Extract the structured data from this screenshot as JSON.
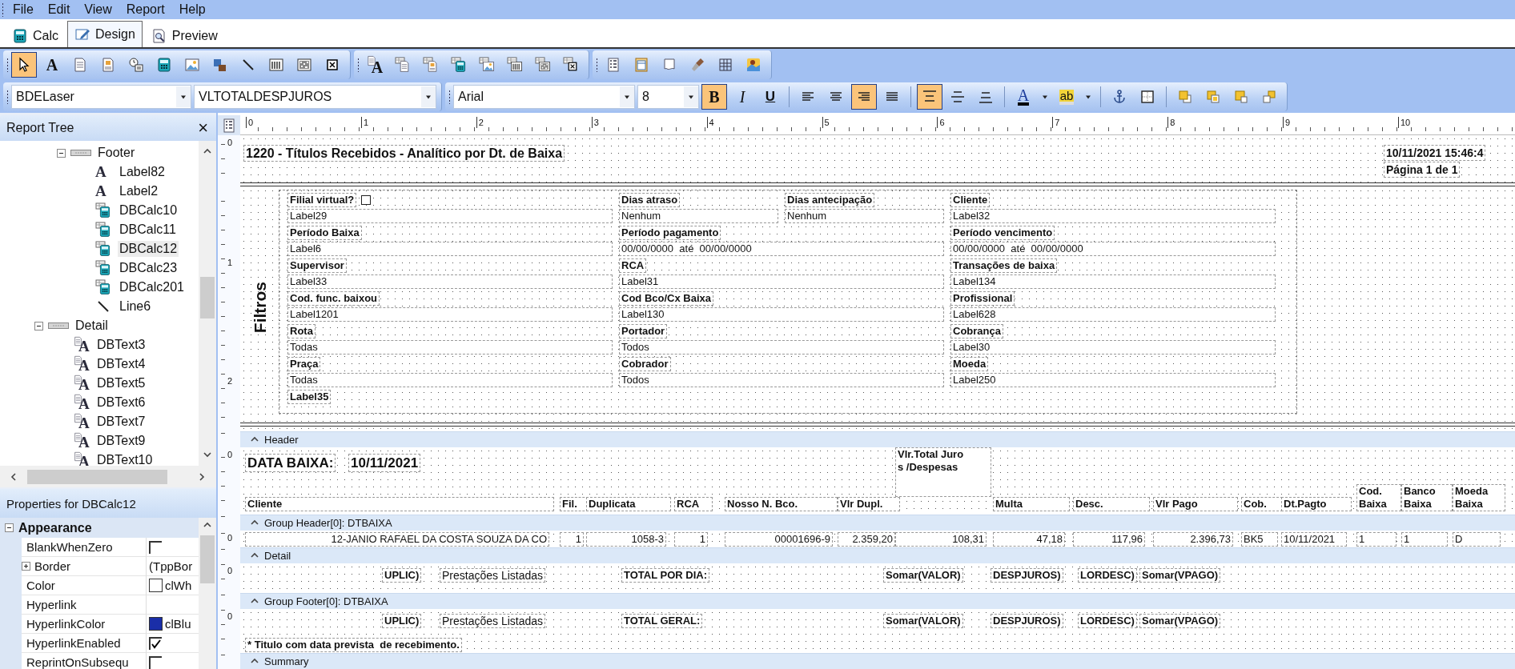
{
  "menu": [
    "File",
    "Edit",
    "View",
    "Report",
    "Help"
  ],
  "tabs": [
    {
      "label": "Calc",
      "selected": false
    },
    {
      "label": "Design",
      "selected": true
    },
    {
      "label": "Preview",
      "selected": false
    }
  ],
  "toolbar_components": {
    "groups": [
      [
        {
          "kind": "pointer",
          "selected": true
        },
        {
          "kind": "letter",
          "glyph": "A",
          "selected": false
        },
        {
          "kind": "page",
          "selected": false
        },
        {
          "kind": "pagea",
          "selected": false
        },
        {
          "kind": "clock",
          "selected": false
        },
        {
          "kind": "calc",
          "selected": false
        },
        {
          "kind": "image",
          "selected": false
        },
        {
          "kind": "figure",
          "selected": false
        },
        {
          "kind": "line",
          "selected": false
        },
        {
          "kind": "columns",
          "selected": false
        },
        {
          "kind": "pattern",
          "selected": false
        },
        {
          "kind": "crossbox",
          "selected": false
        }
      ],
      [
        {
          "kind": "letter",
          "glyph": "A",
          "database": true,
          "selected": false
        },
        {
          "kind": "page",
          "database": true,
          "selected": false
        },
        {
          "kind": "pagea",
          "database": true,
          "selected": false
        },
        {
          "kind": "calc",
          "database": true,
          "selected": false
        },
        {
          "kind": "image",
          "database": true,
          "selected": false
        },
        {
          "kind": "columns",
          "database": true,
          "selected": false
        },
        {
          "kind": "pattern",
          "database": true,
          "selected": false
        },
        {
          "kind": "crossbox",
          "database": true,
          "selected": false
        }
      ],
      [
        {
          "kind": "list",
          "selected": false
        },
        {
          "kind": "table",
          "selected": false
        },
        {
          "kind": "blank",
          "selected": false
        },
        {
          "kind": "brush",
          "selected": false
        },
        {
          "kind": "grid",
          "selected": false
        },
        {
          "kind": "photo",
          "selected": false
        }
      ]
    ]
  },
  "toolbar_format": {
    "groups": [
      [
        {
          "kind": "combo",
          "value": "BDELaser"
        },
        {
          "kind": "combo",
          "value": "VLTOTALDESPJUROS"
        }
      ],
      [
        {
          "kind": "combo",
          "value": "Arial"
        },
        {
          "kind": "combo",
          "value": "8"
        },
        {
          "kind": "bold",
          "glyph": "B",
          "selected": true
        },
        {
          "kind": "italic",
          "glyph": "I",
          "selected": false
        },
        {
          "kind": "underline",
          "glyph": "U",
          "selected": false
        },
        {
          "kind": "separator"
        },
        {
          "kind": "align-left",
          "selected": false
        },
        {
          "kind": "align-center",
          "selected": false
        },
        {
          "kind": "align-right",
          "selected": true
        },
        {
          "kind": "justify",
          "selected": false
        },
        {
          "kind": "separator"
        },
        {
          "kind": "valign-top",
          "selected": true
        },
        {
          "kind": "valign-middle",
          "selected": false
        },
        {
          "kind": "valign-bottom",
          "selected": false
        },
        {
          "kind": "separator"
        },
        {
          "kind": "fontcolor",
          "glyph": "A",
          "selected": false
        },
        {
          "kind": "caret"
        },
        {
          "kind": "highlight",
          "glyph": "ab",
          "selected": false
        },
        {
          "kind": "caret"
        },
        {
          "kind": "separator"
        },
        {
          "kind": "anchor",
          "selected": false
        },
        {
          "kind": "border",
          "selected": false
        },
        {
          "kind": "separator"
        },
        {
          "kind": "front",
          "selected": false
        },
        {
          "kind": "back",
          "selected": false
        },
        {
          "kind": "forward",
          "selected": false
        },
        {
          "kind": "backward",
          "selected": false
        }
      ]
    ]
  },
  "report_tree": {
    "title": "Report Tree",
    "close": "×",
    "items": [
      {
        "children": [
          {
            "label": "Footer",
            "kind": "band",
            "expanded": true,
            "selected": false,
            "children": [
              {
                "label": "Label82",
                "kind": "label",
                "glyph": "A",
                "selected": false
              },
              {
                "label": "Label2",
                "kind": "label",
                "glyph": "A",
                "selected": false
              },
              {
                "label": "DBCalc10",
                "kind": "calc",
                "selected": false
              },
              {
                "label": "DBCalc11",
                "kind": "calc",
                "selected": false
              },
              {
                "label": "DBCalc12",
                "kind": "calc",
                "selected": true
              },
              {
                "label": "DBCalc23",
                "kind": "calc",
                "selected": false
              },
              {
                "label": "DBCalc201",
                "kind": "calc",
                "selected": false
              },
              {
                "label": "Line6",
                "kind": "line",
                "selected": false
              }
            ]
          }
        ]
      },
      {
        "label": "Detail",
        "kind": "band",
        "expanded": true,
        "selected": false,
        "children": [
          {
            "label": "DBText3",
            "kind": "dbtext",
            "glyph": "A",
            "selected": false
          },
          {
            "label": "DBText4",
            "kind": "dbtext",
            "glyph": "A",
            "selected": false
          },
          {
            "label": "DBText5",
            "kind": "dbtext",
            "glyph": "A",
            "selected": false
          },
          {
            "label": "DBText6",
            "kind": "dbtext",
            "glyph": "A",
            "selected": false
          },
          {
            "label": "DBText7",
            "kind": "dbtext",
            "glyph": "A",
            "selected": false
          },
          {
            "label": "DBText9",
            "kind": "dbtext",
            "glyph": "A",
            "selected": false
          },
          {
            "label": "DBText10",
            "kind": "dbtext",
            "glyph": "A",
            "selected": false
          }
        ]
      }
    ]
  },
  "properties": {
    "title": "Properties for DBCalc12",
    "category": {
      "label": "Appearance",
      "expanded": true
    },
    "rows": [
      {
        "name": "BlankWhenZero",
        "kind": "checkbox",
        "checked": false
      },
      {
        "name": "Border",
        "kind": "group",
        "expanded": false,
        "value": "(TppBor"
      },
      {
        "name": "Color",
        "kind": "color",
        "color": "#ffffff",
        "value": "clWh"
      },
      {
        "name": "Hyperlink",
        "kind": "text"
      },
      {
        "name": "HyperlinkColor",
        "kind": "color",
        "color": "#1a2ea8",
        "value": "clBlu"
      },
      {
        "name": "HyperlinkEnabled",
        "kind": "checkbox",
        "checked": true
      },
      {
        "name": "ReprintOnSubsequ",
        "kind": "checkbox",
        "checked": false
      }
    ]
  },
  "ruler": {
    "marks": [
      "0",
      "1",
      "2",
      "3",
      "4",
      "5",
      "6",
      "7",
      "8",
      "9",
      "10"
    ]
  },
  "report": {
    "bands": [
      {
        "kind": "title",
        "ruler": [
          "0"
        ],
        "title": "1220 - Títulos Recebidos - Analítico por Dt. de Baixa",
        "datetime": "10/11/2021 15:46:4",
        "page": "Página 1 de 1"
      },
      {
        "kind": "filters",
        "ruler": [
          "1",
          "2"
        ],
        "caption": "Filtros",
        "rows": [
          [
            {
              "label": "Filial virtual?",
              "value": "Label29",
              "kind": "checkbox",
              "checked": false
            },
            {
              "label": "Dias atraso",
              "value": "Nenhum"
            },
            {
              "label": "Dias antecipação",
              "value": "Nenhum"
            },
            {
              "label": "Cliente",
              "value": "Label32"
            }
          ],
          [
            {
              "label": "Período Baixa",
              "value": "Label6"
            },
            {
              "label": "Período pagamento",
              "value": "00/00/0000  até  00/00/0000"
            },
            {
              "label": "Período vencimento",
              "value": "00/00/0000  até  00/00/0000"
            }
          ],
          [
            {
              "label": "Supervisor",
              "value": "Label33"
            },
            {
              "label": "RCA",
              "value": "Label31"
            },
            {
              "label": "Transações de baixa",
              "value": "Label134"
            }
          ],
          [
            {
              "label": "Cod. func. baixou",
              "value": "Label1201"
            },
            {
              "label": "Cod Bco/Cx Baixa",
              "value": "Label130"
            },
            {
              "label": "Profissional",
              "value": "Label628"
            }
          ],
          [
            {
              "label": "Rota",
              "value": "Todas"
            },
            {
              "label": "Portador",
              "value": "Todos"
            },
            {
              "label": "Cobrança",
              "value": "Label30"
            }
          ],
          [
            {
              "label": "Praça",
              "value": "Todas"
            },
            {
              "label": "Cobrador",
              "value": "Todos"
            },
            {
              "label": "Moeda",
              "value": "Label250"
            }
          ],
          [
            {
              "label": "Label35"
            }
          ]
        ]
      },
      {
        "kind": "bar",
        "label": "Header"
      },
      {
        "kind": "header",
        "ruler": [
          "0"
        ],
        "date_label": "DATA BAIXA:",
        "date_value": "10/11/2021",
        "columns": [
          {
            "lines": [
              "Cliente"
            ]
          },
          {
            "lines": [
              "Fil."
            ]
          },
          {
            "lines": [
              "Duplicata"
            ]
          },
          {
            "lines": [
              "RCA"
            ]
          },
          {
            "lines": [
              "Nosso N. Bco."
            ]
          },
          {
            "lines": [
              "Vlr Dupl."
            ]
          },
          {
            "lines": [
              "Vlr.Total Juro",
              "s /Despesas"
            ]
          },
          {
            "lines": [
              "Multa"
            ]
          },
          {
            "lines": [
              "Desc."
            ]
          },
          {
            "lines": [
              "Vlr Pago"
            ]
          },
          {
            "lines": [
              "Cob."
            ]
          },
          {
            "lines": [
              "Dt.Pagto"
            ]
          },
          {
            "lines": [
              "Cod.",
              "Baixa"
            ]
          },
          {
            "lines": [
              "Banco",
              "Baixa"
            ]
          },
          {
            "lines": [
              "Moeda",
              "Baixa"
            ]
          }
        ]
      },
      {
        "kind": "bar",
        "label": "Group Header[0]: DTBAIXA"
      },
      {
        "kind": "detail",
        "ruler": [
          "0"
        ],
        "values": [
          "12-JANIO RAFAEL DA COSTA SOUZA DA CO",
          "1",
          "1058-3",
          "1",
          "00001696-9",
          "2.359,20",
          "108,31",
          "47,18",
          "117,96",
          "2.396,73",
          "BK5",
          "10/11/2021",
          "1",
          "1",
          "D"
        ]
      },
      {
        "kind": "bar",
        "label": "Detail"
      },
      {
        "kind": "totals",
        "ruler": [
          "0"
        ],
        "items": [
          "UPLIC)",
          "Prestações Listadas",
          "TOTAL POR DIA:",
          "Somar(VALOR)",
          "DESPJUROS)",
          "LORDESC)",
          "Somar(VPAGO)"
        ]
      },
      {
        "kind": "bar",
        "label": "Group Footer[0]: DTBAIXA"
      },
      {
        "kind": "totals",
        "ruler": [
          "0"
        ],
        "items": [
          "UPLIC)",
          "Prestações Listadas",
          "TOTAL GERAL:",
          "Somar(VALOR)",
          "DESPJUROS)",
          "LORDESC)",
          "Somar(VPAGO)"
        ],
        "note": "* Titulo com data prevista  de recebimento."
      },
      {
        "kind": "bar",
        "label": "Summary"
      }
    ]
  }
}
